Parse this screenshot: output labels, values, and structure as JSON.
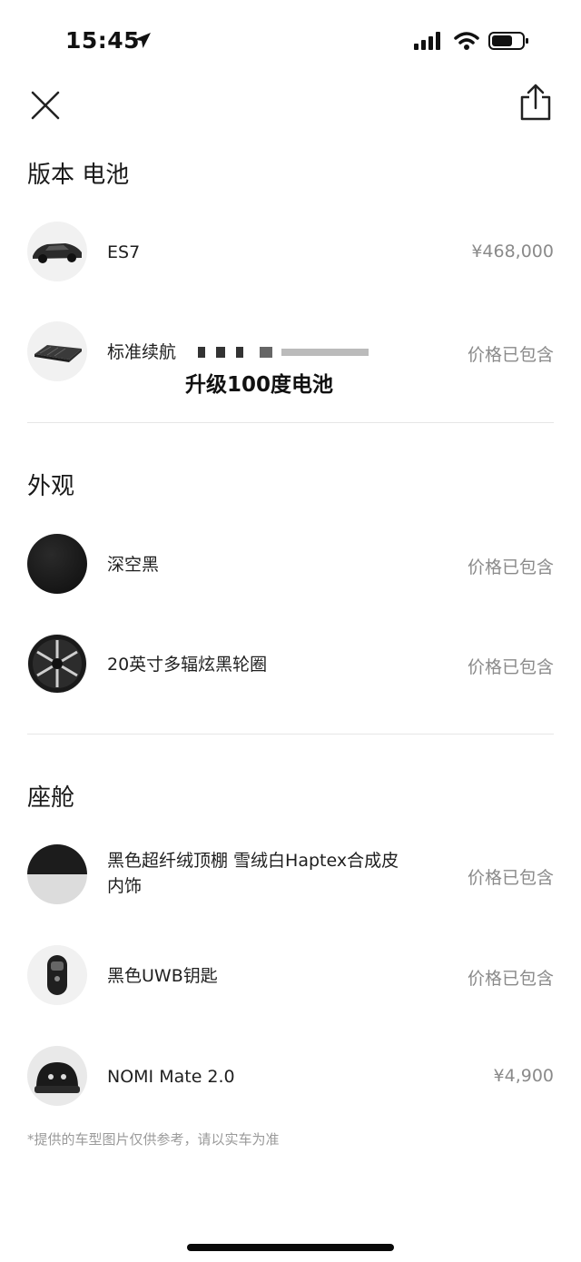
{
  "status_bar": {
    "time": "15:45"
  },
  "nav": {},
  "sections": {
    "version": {
      "title": "版本 电池",
      "items": [
        {
          "label": "ES7",
          "price": "¥468,000",
          "icon": "car-thumbnail"
        },
        {
          "label": "标准续航",
          "price": "价格已包含",
          "icon": "battery-pack-thumbnail"
        }
      ],
      "overlay": "升级100度电池"
    },
    "exterior": {
      "title": "外观",
      "items": [
        {
          "label": "深空黑",
          "price": "价格已包含",
          "icon": "black-color-swatch"
        },
        {
          "label": "20英寸多辐炫黑轮圈",
          "price": "价格已包含",
          "icon": "wheel-thumbnail"
        }
      ]
    },
    "cabin": {
      "title": "座舱",
      "items": [
        {
          "label": "黑色超纤绒顶棚 雪绒白Haptex合成皮内饰",
          "price": "价格已包含",
          "icon": "interior-swatch"
        },
        {
          "label": "黑色UWB钥匙",
          "price": "价格已包含",
          "icon": "uwb-key-thumbnail"
        },
        {
          "label": "NOMI Mate 2.0",
          "price": "¥4,900",
          "icon": "nomi-thumbnail"
        }
      ]
    }
  },
  "footnote": "*提供的车型图片仅供参考，请以实车为准",
  "colors": {
    "text": "#1a1a1a",
    "muted": "#8a8a8a",
    "divider": "#e6e6e6"
  }
}
